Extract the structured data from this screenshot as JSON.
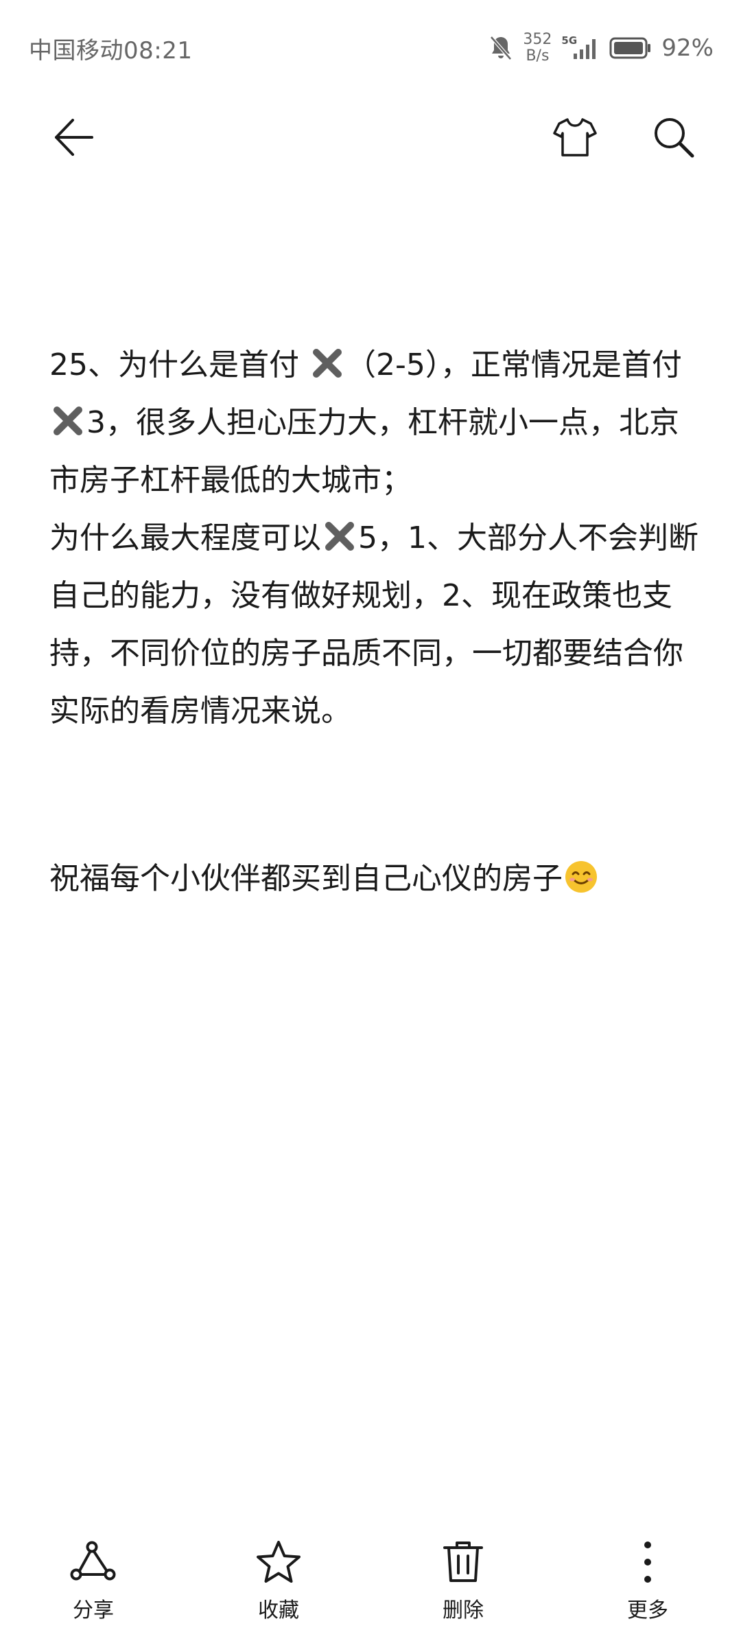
{
  "status_bar": {
    "carrier": "中国移动",
    "time": "08:21",
    "net_speed_value": "352",
    "net_speed_unit": "B/s",
    "network_type": "5G",
    "battery_percent": "92%"
  },
  "note": {
    "paragraph1_a": "25、为什么是首付",
    "paragraph1_b": "（2-5），正常情况是首付",
    "paragraph1_c": "3，很多人担心压力大，杠杆就小一点，北京市房子杠杆最低的大城市；",
    "paragraph2_a": "为什么最大程度可以",
    "paragraph2_b": "5，1、大部分人不会判断自己的能力，没有做好规划，2、现在政策也支持，不同价位的房子品质不同，一切都要结合你实际的看房情况来说。",
    "paragraph3": "祝福每个小伙伴都买到自己心仪的房子",
    "icons": {
      "cross": "cross-mark-emoji",
      "smile": "smiling-face-emoji"
    }
  },
  "toolbar": {
    "share_label": "分享",
    "favorite_label": "收藏",
    "delete_label": "删除",
    "more_label": "更多"
  }
}
